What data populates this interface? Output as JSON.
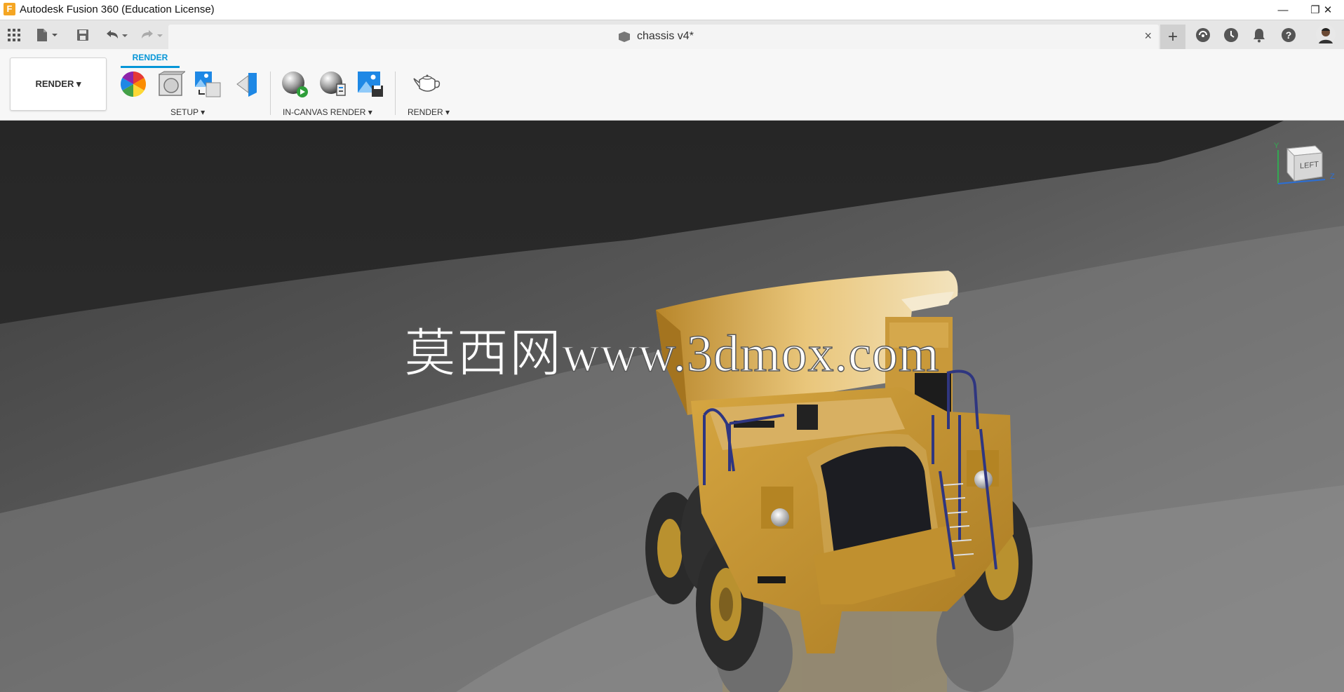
{
  "window": {
    "title": "Autodesk Fusion 360 (Education License)",
    "logo_letter": "F",
    "minimize_glyph": "—",
    "restore_glyph": "❐",
    "close_glyph": "✕"
  },
  "quick_access": {
    "icons": [
      "apps-grid-icon",
      "file-icon",
      "save-icon",
      "undo-icon",
      "redo-icon"
    ]
  },
  "document_tab": {
    "label": "chassis v4*",
    "close_glyph": "×"
  },
  "top_right": {
    "new_tab_glyph": "+",
    "icons": [
      "job-status-icon",
      "history-icon",
      "notifications-icon",
      "help-icon",
      "user-avatar"
    ]
  },
  "ribbon": {
    "workspace_label": "RENDER ▾",
    "active_tab": "RENDER",
    "groups": [
      {
        "label": "SETUP ▾",
        "tools": [
          "appearance-tool",
          "scene-settings-tool",
          "texture-map-tool",
          "decal-tool"
        ]
      },
      {
        "label": "IN-CANVAS RENDER ▾",
        "tools": [
          "in-canvas-render-tool",
          "render-settings-tool",
          "capture-image-tool"
        ]
      },
      {
        "label": "RENDER ▾",
        "tools": [
          "render-teapot-tool"
        ]
      }
    ]
  },
  "viewcube": {
    "face_label": "LEFT",
    "axis_y": "Y",
    "axis_z": "Z"
  },
  "watermark": {
    "text": "莫西网www.3dmox.com"
  },
  "colors": {
    "accent": "#0696d7",
    "truck_body": "#c8982e",
    "background_dark": "#1f1f1f",
    "ground": "#7a7a7a"
  }
}
